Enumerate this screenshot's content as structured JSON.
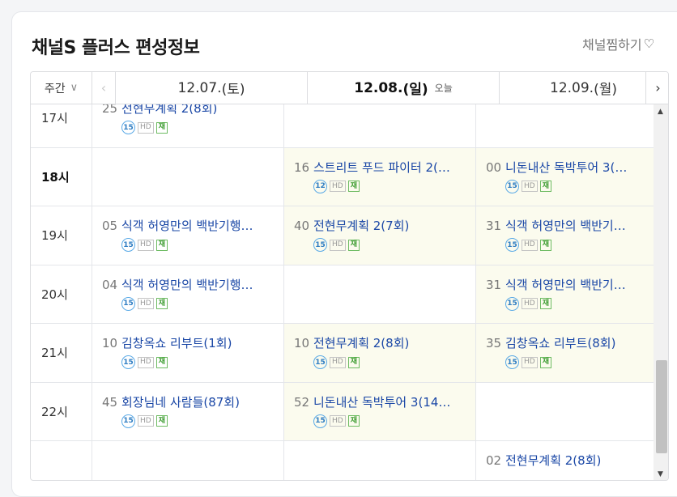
{
  "header": {
    "title": "채널S 플러스 편성정보",
    "favorite_label": "채널찜하기",
    "favorite_icon": "heart-outline-icon"
  },
  "week_selector": {
    "label": "주간"
  },
  "days": [
    {
      "date": "12.07.",
      "weekday": "(토)",
      "today_label": ""
    },
    {
      "date": "12.08.",
      "weekday": "(일)",
      "today_label": "오늘"
    },
    {
      "date": "12.09.",
      "weekday": "(월)",
      "today_label": ""
    }
  ],
  "colors": {
    "link": "#1a47a6",
    "live_background": "#fbfbee",
    "age_badge": "#59a9e6",
    "rerun_badge": "#6dbb62"
  },
  "rows": [
    {
      "hour": "17시",
      "bold": false,
      "cells": [
        {
          "minute": "25",
          "title": "전현무계획 2(8회)",
          "age": "15",
          "hd": "HD",
          "rerun": "재",
          "live": false
        },
        null,
        null
      ]
    },
    {
      "hour": "18시",
      "bold": true,
      "cells": [
        null,
        {
          "minute": "16",
          "title": "스트리트 푸드 파이터 2(…",
          "age": "12",
          "hd": "HD",
          "rerun": "재",
          "live": true
        },
        {
          "minute": "00",
          "title": "니돈내산 독박투어 3(…",
          "age": "15",
          "hd": "HD",
          "rerun": "재",
          "live": true
        }
      ]
    },
    {
      "hour": "19시",
      "bold": false,
      "cells": [
        {
          "minute": "05",
          "title": "식객 허영만의 백반기행…",
          "age": "15",
          "hd": "HD",
          "rerun": "재",
          "live": false
        },
        {
          "minute": "40",
          "title": "전현무계획 2(7회)",
          "age": "15",
          "hd": "HD",
          "rerun": "재",
          "live": true
        },
        {
          "minute": "31",
          "title": "식객 허영만의 백반기…",
          "age": "15",
          "hd": "HD",
          "rerun": "재",
          "live": true
        }
      ]
    },
    {
      "hour": "20시",
      "bold": false,
      "cells": [
        {
          "minute": "04",
          "title": "식객 허영만의 백반기행…",
          "age": "15",
          "hd": "HD",
          "rerun": "재",
          "live": false
        },
        null,
        {
          "minute": "31",
          "title": "식객 허영만의 백반기…",
          "age": "15",
          "hd": "HD",
          "rerun": "재",
          "live": true
        }
      ]
    },
    {
      "hour": "21시",
      "bold": false,
      "cells": [
        {
          "minute": "10",
          "title": "김창옥쇼 리부트(1회)",
          "age": "15",
          "hd": "HD",
          "rerun": "재",
          "live": false
        },
        {
          "minute": "10",
          "title": "전현무계획 2(8회)",
          "age": "15",
          "hd": "HD",
          "rerun": "재",
          "live": true
        },
        {
          "minute": "35",
          "title": "김창옥쇼 리부트(8회)",
          "age": "15",
          "hd": "HD",
          "rerun": "재",
          "live": true
        }
      ]
    },
    {
      "hour": "22시",
      "bold": false,
      "cells": [
        {
          "minute": "45",
          "title": "회장님네 사람들(87회)",
          "age": "15",
          "hd": "HD",
          "rerun": "재",
          "live": false
        },
        {
          "minute": "52",
          "title": "니돈내산 독박투어 3(14…",
          "age": "15",
          "hd": "HD",
          "rerun": "재",
          "live": true
        },
        null
      ]
    },
    {
      "hour": "",
      "bold": false,
      "cells": [
        null,
        null,
        {
          "minute": "02",
          "title": "전현무계획 2(8회)",
          "age": "",
          "hd": "",
          "rerun": "",
          "live": false
        }
      ]
    }
  ]
}
